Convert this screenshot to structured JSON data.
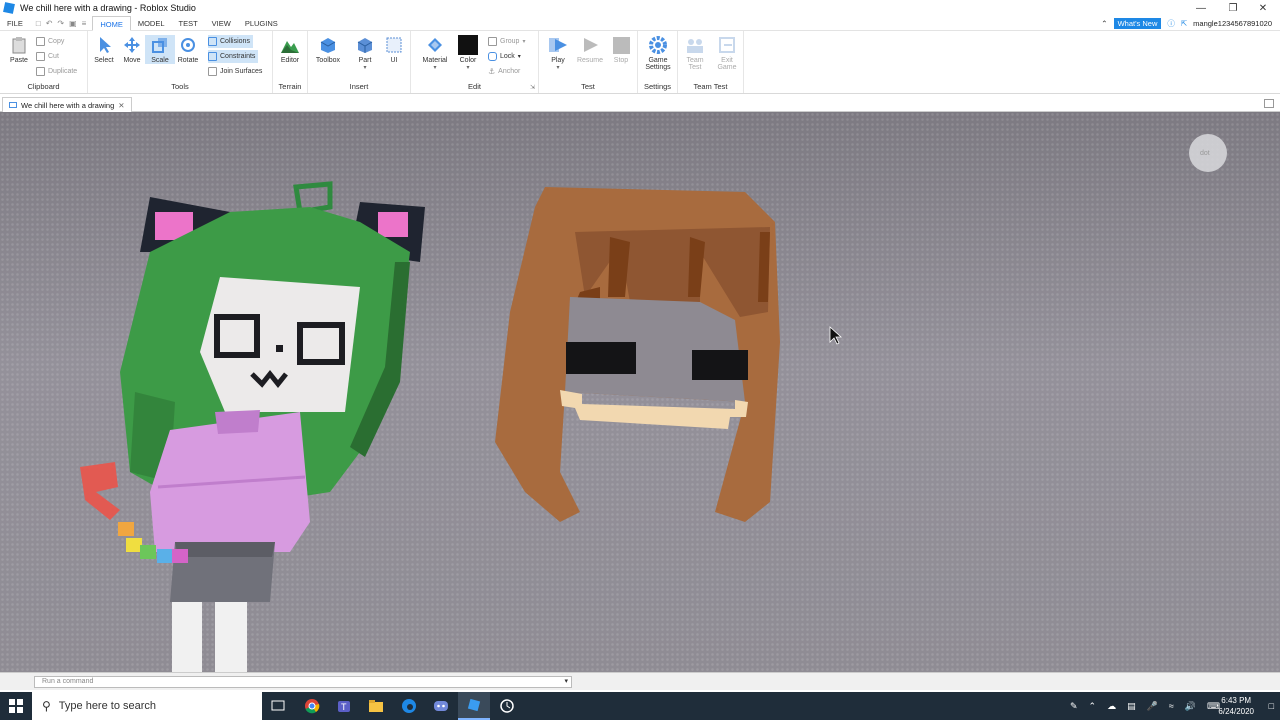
{
  "window": {
    "title": "We chill here with a drawing - Roblox Studio"
  },
  "menu": {
    "file": "FILE",
    "tabs": [
      "HOME",
      "MODEL",
      "TEST",
      "VIEW",
      "PLUGINS"
    ],
    "whats_new": "What's New",
    "username": "mangle1234567891020"
  },
  "ribbon": {
    "clipboard": {
      "paste": "Paste",
      "copy": "Copy",
      "cut": "Cut",
      "duplicate": "Duplicate",
      "label": "Clipboard"
    },
    "tools": {
      "select": "Select",
      "move": "Move",
      "scale": "Scale",
      "rotate": "Rotate",
      "collisions": "Collisions",
      "constraints": "Constraints",
      "join_surfaces": "Join Surfaces",
      "label": "Tools"
    },
    "terrain": {
      "editor": "Editor",
      "label": "Terrain"
    },
    "insert": {
      "toolbox": "Toolbox",
      "part": "Part",
      "ui": "UI",
      "label": "Insert"
    },
    "edit": {
      "material": "Material",
      "color": "Color",
      "group": "Group",
      "lock": "Lock",
      "anchor": "Anchor",
      "label": "Edit"
    },
    "test": {
      "play": "Play",
      "resume": "Resume",
      "stop": "Stop",
      "label": "Test"
    },
    "settings": {
      "game_settings_1": "Game",
      "game_settings_2": "Settings",
      "label": "Settings"
    },
    "team_test": {
      "team_test_1": "Team",
      "team_test_2": "Test",
      "exit_game_1": "Exit",
      "exit_game_2": "Game",
      "label": "Team Test"
    }
  },
  "document_tab": {
    "label": "We chill here with a drawing"
  },
  "command_bar": {
    "placeholder": "Run a command"
  },
  "taskbar": {
    "search_placeholder": "Type here to search",
    "time": "6:43 PM",
    "date": "6/24/2020"
  },
  "colors": {
    "accent": "#1e88e5",
    "viewport_floor": "#8e8a92",
    "hair_green": "#3f9a48",
    "hoodie_pink": "#d898e0",
    "brown_hair": "#a66a3c"
  }
}
